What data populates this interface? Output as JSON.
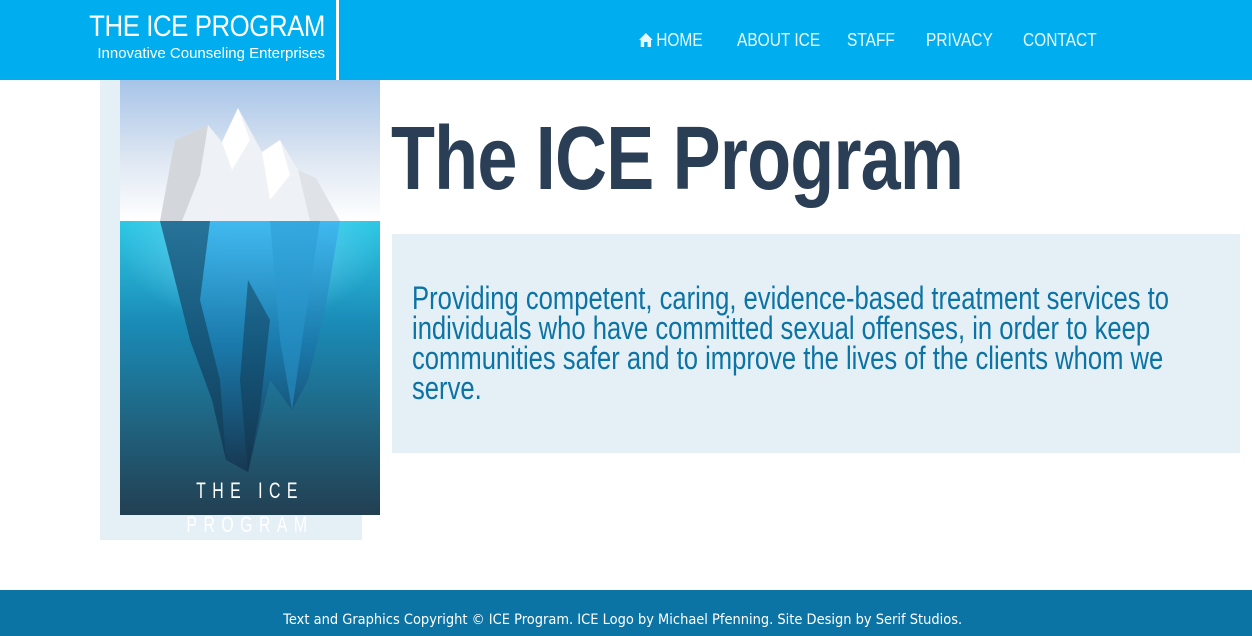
{
  "header": {
    "site_title": "THE ICE PROGRAM",
    "site_subtitle": "Innovative Counseling Enterprises",
    "nav": [
      {
        "label": "HOME",
        "icon": "home-icon"
      },
      {
        "label": "ABOUT ICE"
      },
      {
        "label": "STAFF"
      },
      {
        "label": "PRIVACY"
      },
      {
        "label": "CONTACT"
      }
    ]
  },
  "main": {
    "logo_caption": "THE ICE PROGRAM",
    "title": "The ICE Program",
    "mission": "Providing competent, caring, evidence-based treatment services to individuals who have committed sexual offenses, in order to keep communities safer and to improve the lives of the clients whom we serve."
  },
  "footer": {
    "copyright": "Text and Graphics Copyright © ICE Program. ICE Logo by Michael Pfenning. Site Design by Serif Studios."
  },
  "colors": {
    "header_bg": "#00aeef",
    "footer_bg": "#0c73a5",
    "title_text": "#2a3e56",
    "mission_text": "#0c73a5",
    "panel_bg": "#e4eff6"
  }
}
